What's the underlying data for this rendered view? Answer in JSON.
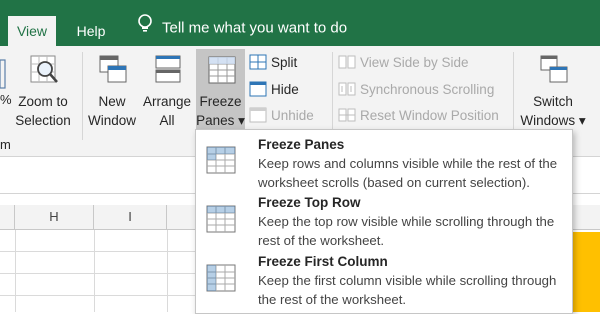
{
  "tabs": {
    "view": "View",
    "help": "Help"
  },
  "tellme": "Tell me what you want to do",
  "ribbon": {
    "zoom_cut": "%",
    "zoom_cut2": "m",
    "zoom_to_selection": [
      "Zoom to",
      "Selection"
    ],
    "new_window": [
      "New",
      "Window"
    ],
    "arrange_all": [
      "Arrange",
      "All"
    ],
    "freeze_panes": [
      "Freeze",
      "Panes ▾"
    ],
    "split": "Split",
    "hide": "Hide",
    "unhide": "Unhide",
    "view_side_by_side": "View Side by Side",
    "synchronous_scrolling": "Synchronous Scrolling",
    "reset_window_position": "Reset Window Position",
    "switch_windows": [
      "Switch",
      "Windows ▾"
    ]
  },
  "columns": [
    "H",
    "I"
  ],
  "menu": {
    "items": [
      {
        "title": "Freeze Panes",
        "desc": "Keep rows and columns visible while the rest of the worksheet scrolls (based on current selection)."
      },
      {
        "title": "Freeze Top Row",
        "desc": "Keep the top row visible while scrolling through the rest of the worksheet."
      },
      {
        "title": "Freeze First Column",
        "desc": "Keep the first column visible while scrolling through the rest of the worksheet."
      }
    ]
  },
  "colors": {
    "excel_green": "#217346",
    "ribbon_bg": "#f3f3f3",
    "highlight": "#ffc000",
    "selected_button": "#c5c5c5"
  }
}
